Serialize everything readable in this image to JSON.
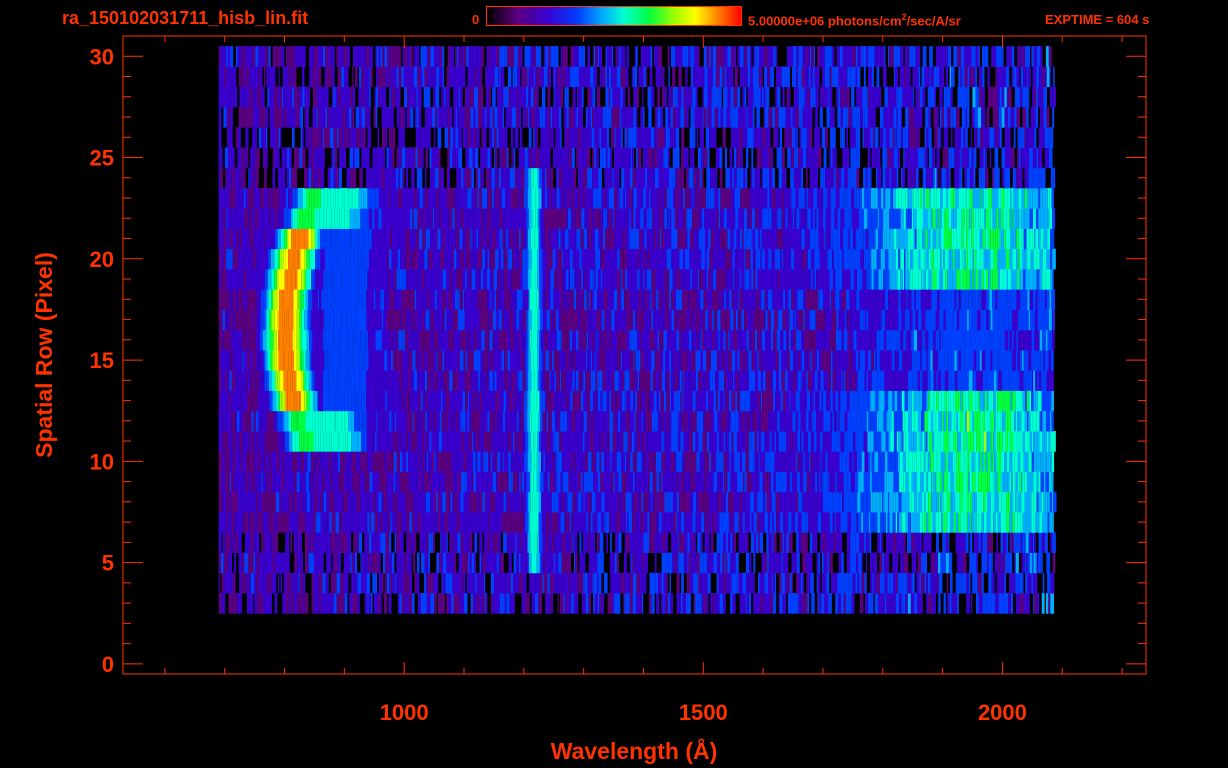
{
  "header": {
    "filename": "ra_150102031711_hisb_lin.fit",
    "colorbar_min": "0",
    "colorbar_max_prefix": "5.00000e+06 photons/cm",
    "colorbar_max_sup": "2",
    "colorbar_max_suffix": "/sec/A/sr",
    "exptime": "EXPTIME = 604 s"
  },
  "colors": {
    "text": "#ff3300",
    "background": "#000000",
    "colormap": [
      "#000000",
      "#5a0080",
      "#3a00d0",
      "#0040ff",
      "#00b0ff",
      "#00ffd0",
      "#00ff40",
      "#a0ff00",
      "#ffff00",
      "#ff8000",
      "#ff0000"
    ]
  },
  "chart_data": {
    "type": "heatmap",
    "xlabel": "Wavelength (Å)",
    "ylabel": "Spatial Row (Pixel)",
    "xlim": [
      530,
      2240
    ],
    "ylim": [
      -0.5,
      31
    ],
    "xticks": [
      1000,
      1500,
      2000
    ],
    "yticks": [
      0,
      5,
      10,
      15,
      20,
      25,
      30
    ],
    "color_scale_max": 5000000,
    "color_scale_unit": "photons/cm^2/sec/A/sr",
    "data_wavelength_range": [
      690,
      2085
    ],
    "rows_with_signal": [
      3,
      30
    ],
    "features": [
      {
        "wavelength_center": 800,
        "rows": [
          11,
          23
        ],
        "peak_rows": [
          13,
          21
        ],
        "relative_intensity": 0.95
      },
      {
        "wavelength_center": 1215,
        "rows": [
          5,
          24
        ],
        "relative_intensity": 0.55
      },
      {
        "wavelength_center": 1950,
        "rows": [
          7,
          23
        ],
        "relative_intensity": 0.55
      }
    ]
  }
}
